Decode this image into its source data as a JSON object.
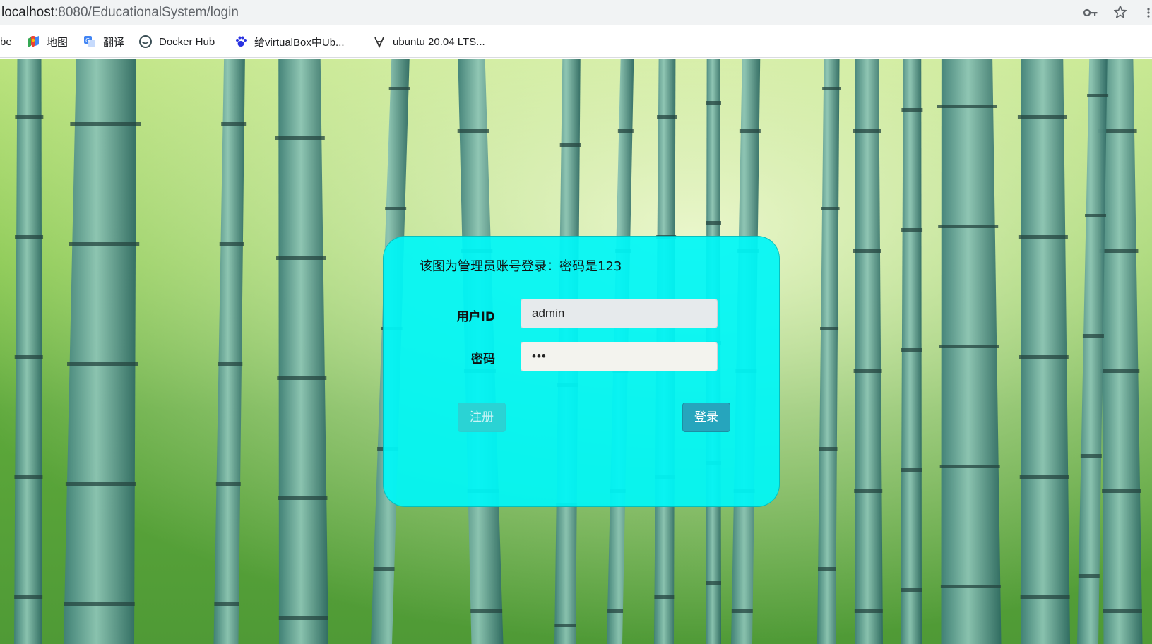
{
  "browser": {
    "url_host": "localhost",
    "url_rest": ":8080/EducationalSystem/login",
    "icons": [
      "key-icon",
      "star-icon",
      "more-icon"
    ]
  },
  "bookmarks": [
    {
      "label": "be",
      "icon": ""
    },
    {
      "label": "地图",
      "icon": "maps-icon"
    },
    {
      "label": "翻译",
      "icon": "translate-icon"
    },
    {
      "label": "Docker Hub",
      "icon": "docker-icon"
    },
    {
      "label": "给virtualBox中Ub...",
      "icon": "baidu-paw-icon"
    },
    {
      "label": "ubuntu 20.04 LTS...",
      "icon": "ubuntu-link-icon"
    }
  ],
  "login": {
    "notice": "该图为管理员账号登录：密码是123",
    "user_label": "用户ID",
    "user_value": "admin",
    "password_label": "密码",
    "password_value": "•••",
    "register_label": "注册",
    "login_label": "登录"
  },
  "colors": {
    "panel": "#00f6f6",
    "login_button": "#26a5bd",
    "register_button": "#2ad3d4"
  }
}
